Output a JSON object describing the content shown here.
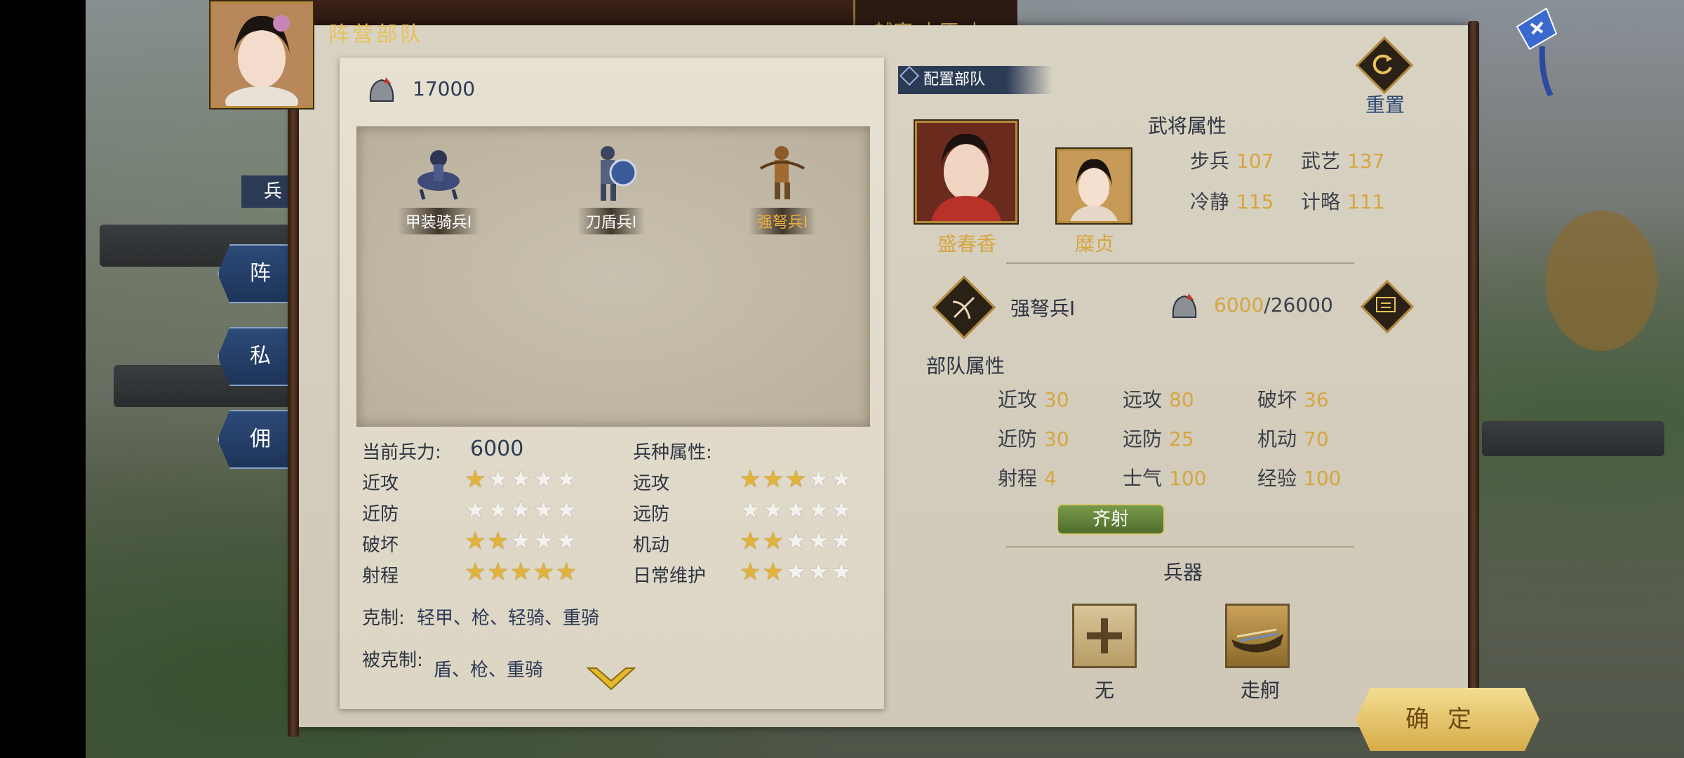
{
  "header": {
    "title": "阵营部队",
    "right_text": "越寨 中原 小"
  },
  "side_tabs": [
    "兵",
    "阵",
    "私",
    "佣"
  ],
  "troop_pool": {
    "total": "17000",
    "units": [
      {
        "name": "甲装骑兵Ⅰ",
        "selected": false
      },
      {
        "name": "刀盾兵Ⅰ",
        "selected": false
      },
      {
        "name": "强弩兵Ⅰ",
        "selected": true
      }
    ]
  },
  "unit_detail": {
    "current_label": "当前兵力:",
    "current_value": "6000",
    "type_attr_label": "兵种属性:",
    "ratings": [
      {
        "label": "近攻",
        "stars": 1
      },
      {
        "label": "远攻",
        "stars": 3
      },
      {
        "label": "近防",
        "stars": 0
      },
      {
        "label": "远防",
        "stars": 0
      },
      {
        "label": "破坏",
        "stars": 2
      },
      {
        "label": "机动",
        "stars": 2
      },
      {
        "label": "射程",
        "stars": 5
      },
      {
        "label": "日常维护",
        "stars": 2
      }
    ],
    "counters_label": "克制:",
    "counters_value": "轻甲、枪、轻骑、重骑",
    "countered_label": "被克制:",
    "countered_value": "盾、枪、重骑"
  },
  "config": {
    "tab_label": "配置部队",
    "reset_label": "重置",
    "general_attr_title": "武将属性",
    "main_general": "盛春香",
    "vice_general": "糜贞",
    "general_stats": [
      {
        "label": "步兵",
        "value": "107"
      },
      {
        "label": "武艺",
        "value": "137"
      },
      {
        "label": "冷静",
        "value": "115"
      },
      {
        "label": "计略",
        "value": "111"
      }
    ],
    "unit_type": "强弩兵Ⅰ",
    "troops_current": "6000",
    "troops_max": "/26000",
    "troop_attr_title": "部队属性",
    "troop_stats": [
      {
        "label": "近攻",
        "value": "30"
      },
      {
        "label": "远攻",
        "value": "80"
      },
      {
        "label": "破坏",
        "value": "36"
      },
      {
        "label": "近防",
        "value": "30"
      },
      {
        "label": "远防",
        "value": "25"
      },
      {
        "label": "机动",
        "value": "70"
      },
      {
        "label": "射程",
        "value": "4"
      },
      {
        "label": "士气",
        "value": "100"
      },
      {
        "label": "经验",
        "value": "100"
      }
    ],
    "skill": "齐射",
    "weapons_title": "兵器",
    "weapons": [
      "无",
      "走舸"
    ]
  },
  "confirm_label": "确定",
  "colors": {
    "gold": "#d6a640",
    "panel": "#d9d3c4",
    "navy": "#2b3a55"
  }
}
